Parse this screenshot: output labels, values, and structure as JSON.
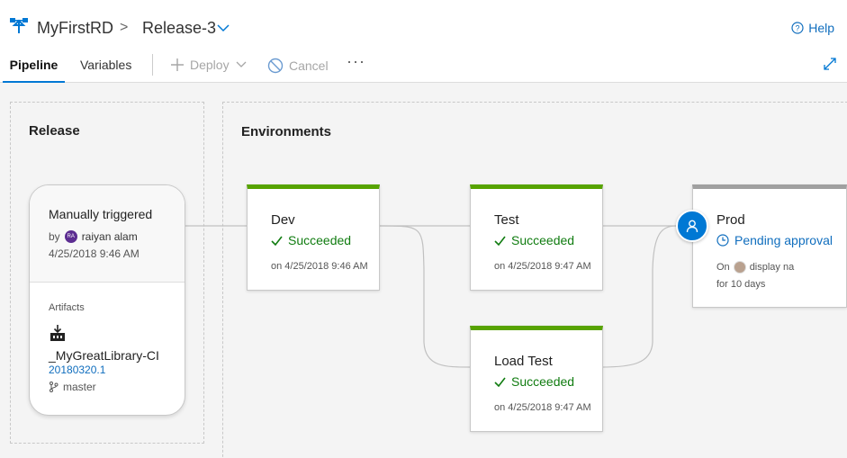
{
  "breadcrumb": {
    "pipeline_name": "MyFirstRD",
    "separator": ">",
    "release_name": "Release-3"
  },
  "header": {
    "help_label": "Help"
  },
  "tabs": [
    {
      "label": "Pipeline",
      "active": true
    },
    {
      "label": "Variables",
      "active": false
    }
  ],
  "toolbar": {
    "deploy_label": "Deploy",
    "cancel_label": "Cancel",
    "more_label": "···"
  },
  "release_panel": {
    "title": "Release",
    "trigger": "Manually triggered",
    "by_label": "by",
    "avatar_initials": "RA",
    "user": "raiyan alam",
    "date": "4/25/2018 9:46 AM",
    "artifacts_label": "Artifacts",
    "artifact_name": "_MyGreatLibrary-CI",
    "build": "20180320.1",
    "branch": "master"
  },
  "environments_panel": {
    "title": "Environments",
    "envs": [
      {
        "name": "Dev",
        "status": "Succeeded",
        "when": "on 4/25/2018 9:46 AM"
      },
      {
        "name": "Test",
        "status": "Succeeded",
        "when": "on 4/25/2018 9:47 AM"
      },
      {
        "name": "Load Test",
        "status": "Succeeded",
        "when": "on 4/25/2018 9:47 AM"
      },
      {
        "name": "Prod",
        "status": "Pending approval",
        "when_prefix": "On",
        "approver": "display na",
        "duration": "for 10 days"
      }
    ]
  },
  "colors": {
    "accent": "#0078d4",
    "success": "#57a300",
    "pending": "#a0a0a0"
  }
}
